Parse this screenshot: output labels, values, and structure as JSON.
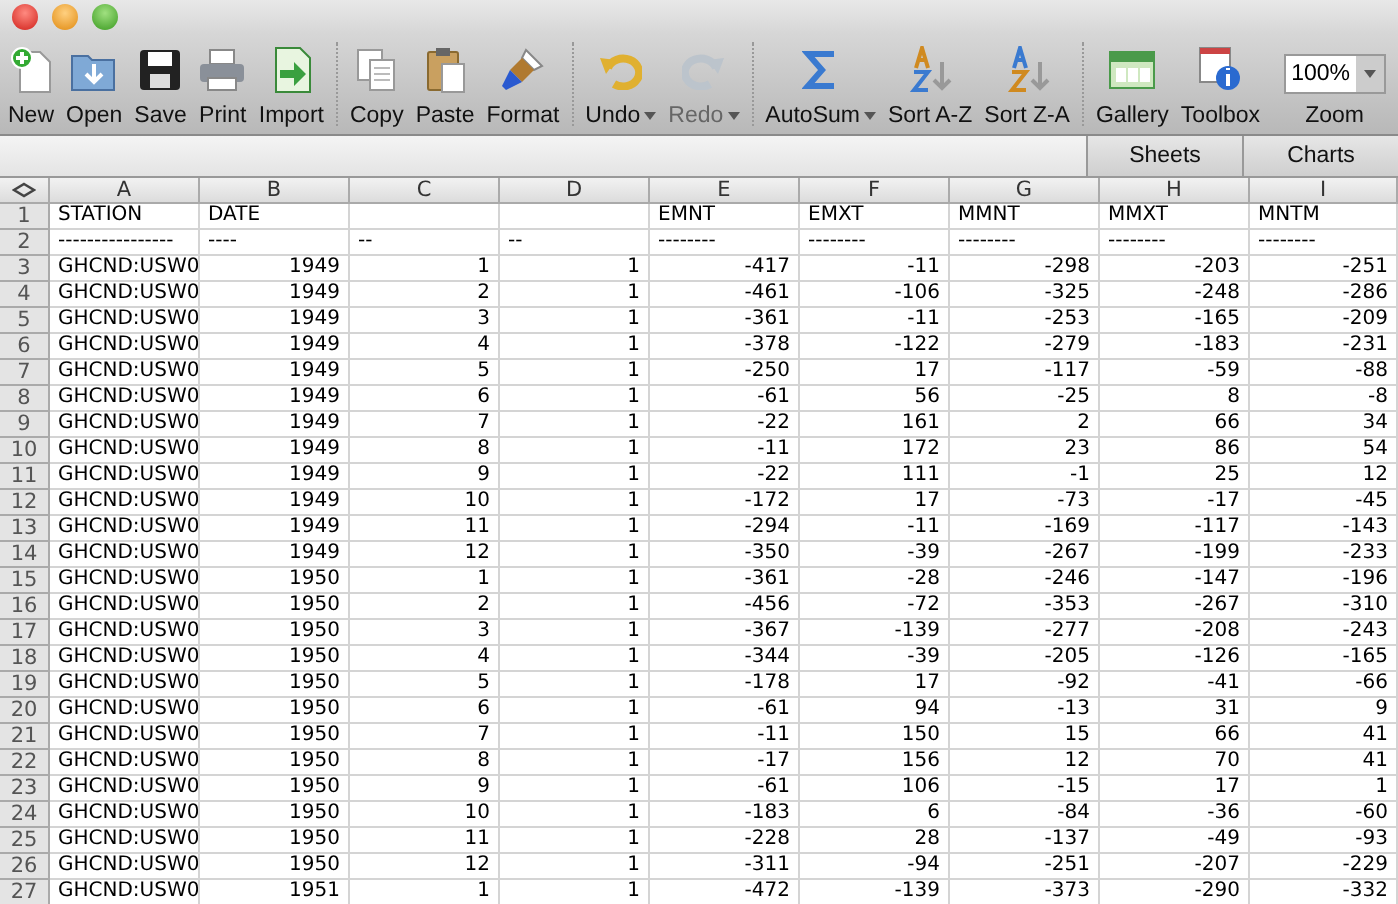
{
  "toolbar": {
    "groups": [
      [
        {
          "label": "New",
          "kind": "new"
        },
        {
          "label": "Open",
          "kind": "open"
        },
        {
          "label": "Save",
          "kind": "save"
        },
        {
          "label": "Print",
          "kind": "print"
        },
        {
          "label": "Import",
          "kind": "import"
        }
      ],
      [
        {
          "label": "Copy",
          "kind": "copy"
        },
        {
          "label": "Paste",
          "kind": "paste"
        },
        {
          "label": "Format",
          "kind": "format"
        }
      ],
      [
        {
          "label": "Undo",
          "kind": "undo",
          "dropdown": true,
          "disabled": false
        },
        {
          "label": "Redo",
          "kind": "redo",
          "dropdown": true,
          "disabled": true
        }
      ],
      [
        {
          "label": "AutoSum",
          "kind": "sum",
          "dropdown": true
        },
        {
          "label": "Sort A-Z",
          "kind": "sortaz"
        },
        {
          "label": "Sort Z-A",
          "kind": "sortza"
        }
      ],
      [
        {
          "label": "Gallery",
          "kind": "gallery"
        },
        {
          "label": "Toolbox",
          "kind": "toolbox"
        }
      ]
    ],
    "zoom": {
      "label": "Zoom",
      "value": "100%"
    }
  },
  "ribbon_tabs": [
    {
      "label": "Sheets",
      "selected": false
    },
    {
      "label": "Charts",
      "selected": false
    }
  ],
  "sheet": {
    "columns": [
      "A",
      "B",
      "C",
      "D",
      "E",
      "F",
      "G",
      "H",
      "I"
    ],
    "rows": [
      {
        "num": "1",
        "kind": "header",
        "cells": [
          "STATION",
          "DATE",
          null,
          null,
          "EMNT",
          "EMXT",
          "MMNT",
          "MMXT",
          "MNTM"
        ]
      },
      {
        "num": "2",
        "kind": "header",
        "cells": [
          "----------------",
          "----",
          "--",
          "--",
          "--------",
          "--------",
          "--------",
          "--------",
          "--------"
        ]
      },
      {
        "num": "3",
        "kind": "data",
        "cells": [
          "GHCND:USW0",
          "1949",
          "1",
          "1",
          "-417",
          "-11",
          "-298",
          "-203",
          "-251"
        ]
      },
      {
        "num": "4",
        "kind": "data",
        "cells": [
          "GHCND:USW0",
          "1949",
          "2",
          "1",
          "-461",
          "-106",
          "-325",
          "-248",
          "-286"
        ]
      },
      {
        "num": "5",
        "kind": "data",
        "cells": [
          "GHCND:USW0",
          "1949",
          "3",
          "1",
          "-361",
          "-11",
          "-253",
          "-165",
          "-209"
        ]
      },
      {
        "num": "6",
        "kind": "data",
        "cells": [
          "GHCND:USW0",
          "1949",
          "4",
          "1",
          "-378",
          "-122",
          "-279",
          "-183",
          "-231"
        ]
      },
      {
        "num": "7",
        "kind": "data",
        "cells": [
          "GHCND:USW0",
          "1949",
          "5",
          "1",
          "-250",
          "17",
          "-117",
          "-59",
          "-88"
        ]
      },
      {
        "num": "8",
        "kind": "data",
        "cells": [
          "GHCND:USW0",
          "1949",
          "6",
          "1",
          "-61",
          "56",
          "-25",
          "8",
          "-8"
        ]
      },
      {
        "num": "9",
        "kind": "data",
        "cells": [
          "GHCND:USW0",
          "1949",
          "7",
          "1",
          "-22",
          "161",
          "2",
          "66",
          "34"
        ]
      },
      {
        "num": "10",
        "kind": "data",
        "cells": [
          "GHCND:USW0",
          "1949",
          "8",
          "1",
          "-11",
          "172",
          "23",
          "86",
          "54"
        ]
      },
      {
        "num": "11",
        "kind": "data",
        "cells": [
          "GHCND:USW0",
          "1949",
          "9",
          "1",
          "-22",
          "111",
          "-1",
          "25",
          "12"
        ]
      },
      {
        "num": "12",
        "kind": "data",
        "cells": [
          "GHCND:USW0",
          "1949",
          "10",
          "1",
          "-172",
          "17",
          "-73",
          "-17",
          "-45"
        ]
      },
      {
        "num": "13",
        "kind": "data",
        "cells": [
          "GHCND:USW0",
          "1949",
          "11",
          "1",
          "-294",
          "-11",
          "-169",
          "-117",
          "-143"
        ]
      },
      {
        "num": "14",
        "kind": "data",
        "cells": [
          "GHCND:USW0",
          "1949",
          "12",
          "1",
          "-350",
          "-39",
          "-267",
          "-199",
          "-233"
        ]
      },
      {
        "num": "15",
        "kind": "data",
        "cells": [
          "GHCND:USW0",
          "1950",
          "1",
          "1",
          "-361",
          "-28",
          "-246",
          "-147",
          "-196"
        ]
      },
      {
        "num": "16",
        "kind": "data",
        "cells": [
          "GHCND:USW0",
          "1950",
          "2",
          "1",
          "-456",
          "-72",
          "-353",
          "-267",
          "-310"
        ]
      },
      {
        "num": "17",
        "kind": "data",
        "cells": [
          "GHCND:USW0",
          "1950",
          "3",
          "1",
          "-367",
          "-139",
          "-277",
          "-208",
          "-243"
        ]
      },
      {
        "num": "18",
        "kind": "data",
        "cells": [
          "GHCND:USW0",
          "1950",
          "4",
          "1",
          "-344",
          "-39",
          "-205",
          "-126",
          "-165"
        ]
      },
      {
        "num": "19",
        "kind": "data",
        "cells": [
          "GHCND:USW0",
          "1950",
          "5",
          "1",
          "-178",
          "17",
          "-92",
          "-41",
          "-66"
        ]
      },
      {
        "num": "20",
        "kind": "data",
        "cells": [
          "GHCND:USW0",
          "1950",
          "6",
          "1",
          "-61",
          "94",
          "-13",
          "31",
          "9"
        ]
      },
      {
        "num": "21",
        "kind": "data",
        "cells": [
          "GHCND:USW0",
          "1950",
          "7",
          "1",
          "-11",
          "150",
          "15",
          "66",
          "41"
        ]
      },
      {
        "num": "22",
        "kind": "data",
        "cells": [
          "GHCND:USW0",
          "1950",
          "8",
          "1",
          "-17",
          "156",
          "12",
          "70",
          "41"
        ]
      },
      {
        "num": "23",
        "kind": "data",
        "cells": [
          "GHCND:USW0",
          "1950",
          "9",
          "1",
          "-61",
          "106",
          "-15",
          "17",
          "1"
        ]
      },
      {
        "num": "24",
        "kind": "data",
        "cells": [
          "GHCND:USW0",
          "1950",
          "10",
          "1",
          "-183",
          "6",
          "-84",
          "-36",
          "-60"
        ]
      },
      {
        "num": "25",
        "kind": "data",
        "cells": [
          "GHCND:USW0",
          "1950",
          "11",
          "1",
          "-228",
          "28",
          "-137",
          "-49",
          "-93"
        ]
      },
      {
        "num": "26",
        "kind": "data",
        "cells": [
          "GHCND:USW0",
          "1950",
          "12",
          "1",
          "-311",
          "-94",
          "-251",
          "-207",
          "-229"
        ]
      },
      {
        "num": "27",
        "kind": "data",
        "cells": [
          "GHCND:USW0",
          "1951",
          "1",
          "1",
          "-472",
          "-139",
          "-373",
          "-290",
          "-332"
        ]
      }
    ]
  }
}
